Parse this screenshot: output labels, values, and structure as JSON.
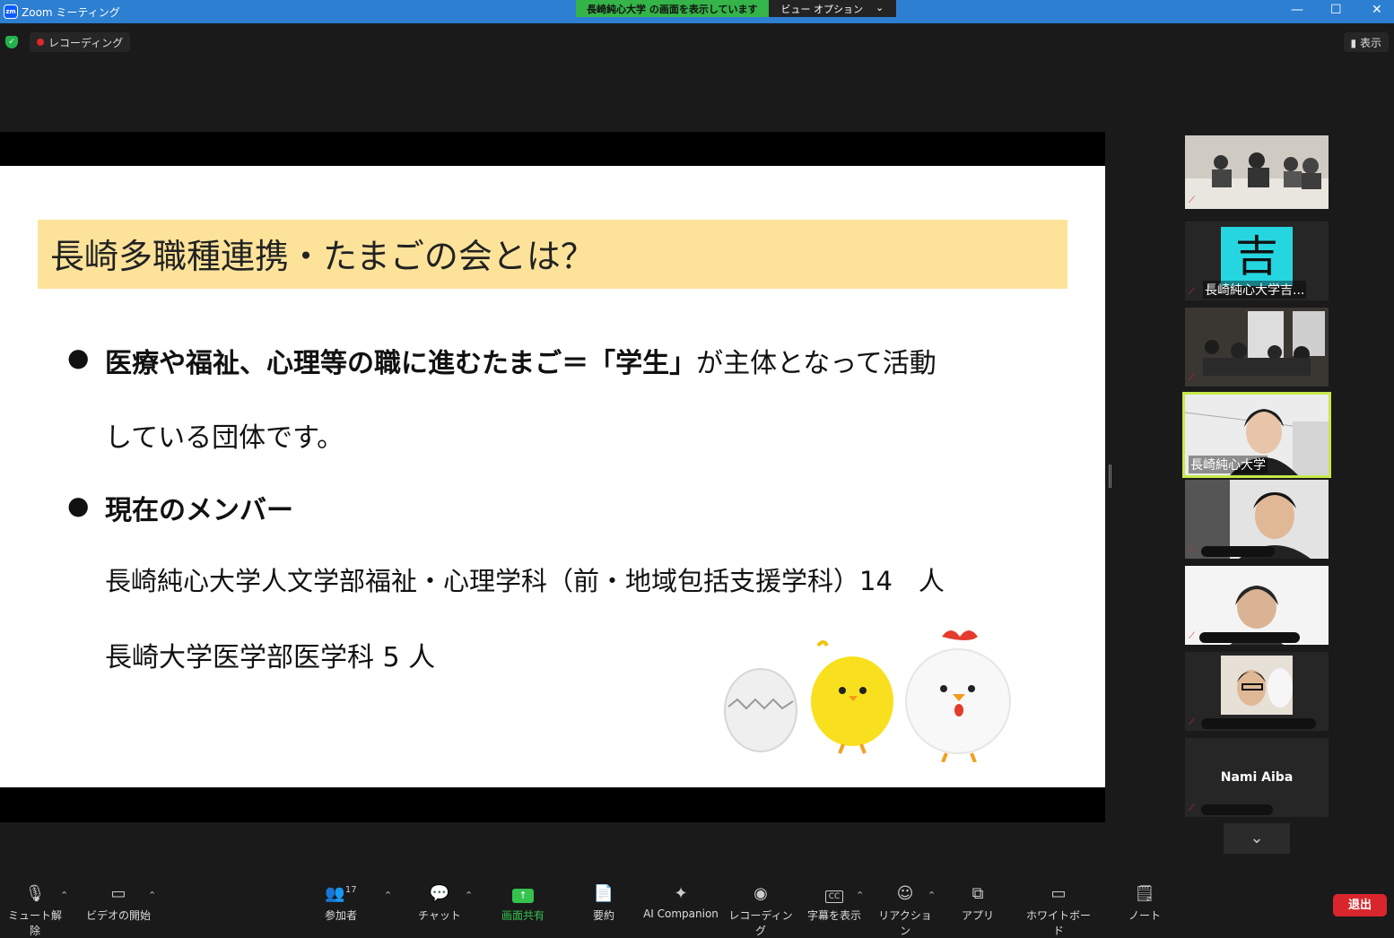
{
  "window": {
    "app_icon_text": "zm",
    "title": "Zoom ミーティング"
  },
  "share_banner": {
    "label": "長崎純心大学 の画面を表示しています",
    "view_options": "ビュー オプション"
  },
  "topbar": {
    "recording": "レコーディング",
    "view": "表示"
  },
  "slide": {
    "title": "長崎多職種連携・たまごの会とは？",
    "bullet1_bold": "医療や福祉、心理等の職に進むたまご＝「学生」",
    "bullet1_rest": "が主体となって活動",
    "bullet1_line2": "している団体です。",
    "bullet2": "現在のメンバー",
    "member1": "長崎純心大学人文学部福祉・心理学科（前・地域包括支援学科）14　人",
    "member2": "長崎大学医学部医学科 5 人",
    "bullet_symbol": "●"
  },
  "gallery": [
    {
      "name": ""
    },
    {
      "avatar": "吉",
      "name": "長崎純心大学吉..."
    },
    {
      "name": ""
    },
    {
      "name": "長崎純心大学",
      "active": true
    },
    {
      "name": ""
    },
    {
      "name": ""
    },
    {
      "name": ""
    },
    {
      "name": "Nami Aiba"
    }
  ],
  "toolbar": {
    "mute": "ミュート解除",
    "video": "ビデオの開始",
    "participants": "参加者",
    "participant_count": "17",
    "chat": "チャット",
    "share": "画面共有",
    "summary": "要約",
    "ai": "AI Companion",
    "record": "レコーディング",
    "captions": "字幕を表示",
    "reactions": "リアクション",
    "apps": "アプリ",
    "whiteboard": "ホワイトボード",
    "notes": "ノート",
    "leave": "退出"
  },
  "colors": {
    "accent": "#2d7fd1",
    "share_green": "#35b44a",
    "leave_red": "#d9262c",
    "title_fill": "#fde39a",
    "active_border": "#c6e84a"
  }
}
